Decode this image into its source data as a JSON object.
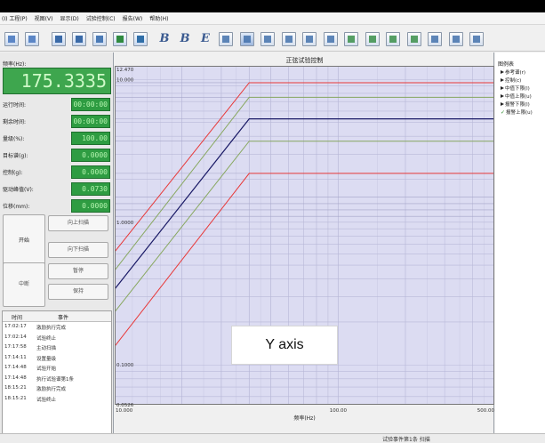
{
  "menu": [
    "(I) 工程(P)",
    "视图(V)",
    "显示(D)",
    "试验控制(C)",
    "报告(W)",
    "帮助(H)"
  ],
  "toolbar": {
    "buttons": [
      {
        "name": "new-file-icon",
        "color": "#5b86c6"
      },
      {
        "name": "save-icon",
        "color": "#5b86c6"
      },
      {
        "name": "open-icon",
        "color": "#3a6aa8"
      },
      {
        "name": "grid-icon",
        "color": "#3a6aa8"
      },
      {
        "name": "table-icon",
        "color": "#4a7ab6"
      },
      {
        "name": "report-icon",
        "color": "#2f8a3f"
      },
      {
        "name": "export-icon",
        "color": "#2f6ea8"
      }
    ],
    "glyphs": [
      "B",
      "B",
      "E"
    ],
    "buttons2": [
      {
        "name": "align-icon",
        "color": "#3a6aa8"
      },
      {
        "name": "chart-view-icon",
        "color": "#3a6aa8"
      },
      {
        "name": "data-view-icon",
        "color": "#3a6aa8"
      },
      {
        "name": "layout-icon",
        "color": "#3a6aa8"
      },
      {
        "name": "zoom-in-icon",
        "color": "#3a6aa8"
      },
      {
        "name": "zoom-out-icon",
        "color": "#3a6aa8"
      },
      {
        "name": "cursor-icon",
        "color": "#2f8a3f"
      },
      {
        "name": "fit-icon",
        "color": "#2f8a3f"
      },
      {
        "name": "peak-icon",
        "color": "#2f8a3f"
      },
      {
        "name": "valley-icon",
        "color": "#2f8a3f"
      },
      {
        "name": "bars-icon",
        "color": "#3a6aa8"
      },
      {
        "name": "list-icon",
        "color": "#3a6aa8"
      },
      {
        "name": "print-icon",
        "color": "#3a6aa8"
      }
    ]
  },
  "left": {
    "freq_label": "频率(Hz):",
    "freq_value": "175.3335",
    "rows": [
      {
        "label": "运行时间:",
        "value": "00:00:00"
      },
      {
        "label": "剩余时间:",
        "value": "00:00:00"
      },
      {
        "label": "量级(%):",
        "value": "100.00"
      },
      {
        "label": "目标谱(g):",
        "value": "0.0000"
      },
      {
        "label": "控制(g):",
        "value": "0.0000"
      },
      {
        "label": "驱动峰值(V):",
        "value": "0.0730"
      },
      {
        "label": "位移(mm):",
        "value": "0.0000"
      }
    ],
    "buttons": {
      "start": "开始",
      "sweep_up": "向上扫描",
      "sweep_down": "向下扫描",
      "stop": "中断",
      "pause": "暂停",
      "hold": "保持"
    },
    "log": {
      "col_time": "时间",
      "col_event": "事件",
      "rows": [
        {
          "time": "17:02:17",
          "event": "激励执行完成"
        },
        {
          "time": "17:02:14",
          "event": "试验终止"
        },
        {
          "time": "17:17:58",
          "event": "主动扫描"
        },
        {
          "time": "17:14:11",
          "event": "设置量级"
        },
        {
          "time": "17:14:48",
          "event": "试验开始"
        },
        {
          "time": "17:14:48",
          "event": "执行试验谱第1条"
        },
        {
          "time": "18:15:21",
          "event": "激励执行完成"
        },
        {
          "time": "18:15:21",
          "event": "试验终止"
        }
      ]
    }
  },
  "chart_data": {
    "type": "line",
    "title": "正弦试验控制",
    "xlabel": "频率(Hz)",
    "ylabel": "",
    "x_scale": "log",
    "y_scale": "log",
    "xlim": [
      10,
      500
    ],
    "ylim": [
      0.0526,
      12.47
    ],
    "x_ticks": [
      "10.000",
      "100.00",
      "500.00"
    ],
    "y_ticks": [
      "12.470",
      "10.000",
      "1.0000",
      "0.1000",
      "0.0526"
    ],
    "grid": true,
    "background": "#dcdcf2",
    "series": [
      {
        "name": "参考谱",
        "color": "#1a1a66",
        "points": [
          [
            10,
            0.34
          ],
          [
            40,
            5.3
          ],
          [
            500,
            5.3
          ]
        ]
      },
      {
        "name": "中值下限",
        "color": "#88a860",
        "points": [
          [
            10,
            0.235
          ],
          [
            40,
            3.7
          ],
          [
            500,
            3.7
          ]
        ]
      },
      {
        "name": "中值上限",
        "color": "#88a860",
        "points": [
          [
            10,
            0.46
          ],
          [
            40,
            7.5
          ],
          [
            500,
            7.5
          ]
        ]
      },
      {
        "name": "报警下限",
        "color": "#e83838",
        "points": [
          [
            10,
            0.135
          ],
          [
            40,
            2.2
          ],
          [
            500,
            2.2
          ]
        ]
      },
      {
        "name": "报警上限",
        "color": "#e83838",
        "points": [
          [
            10,
            0.62
          ],
          [
            40,
            9.5
          ],
          [
            500,
            9.5
          ]
        ]
      }
    ],
    "extra_gridlines_y": [
      1.5,
      1.35,
      1.22,
      1.1,
      2.2,
      3.7,
      5.3,
      7.5,
      9.5
    ]
  },
  "overlay_label": "Y axis",
  "legend": {
    "title": "图例表",
    "items": [
      {
        "label": "参考谱(r)",
        "checked": false
      },
      {
        "label": "控制(c)",
        "checked": false
      },
      {
        "label": "中值下限(l)",
        "checked": false
      },
      {
        "label": "中值上限(u)",
        "checked": false
      },
      {
        "label": "报警下限(l)",
        "checked": false
      },
      {
        "label": "报警上限(u)",
        "checked": true
      }
    ]
  },
  "status": "试验事件第1条 扫描"
}
